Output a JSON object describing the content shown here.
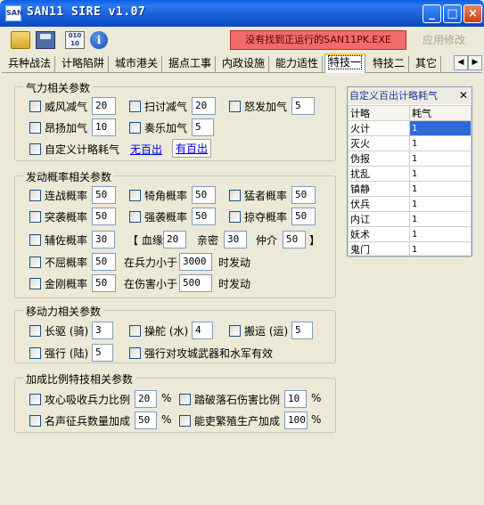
{
  "window": {
    "title": "SAN11 SIRE v1.07",
    "icon_text": "SAN"
  },
  "toolbar": {
    "status_text": "没有找到正运行的SAN11PK.EXE",
    "apply_label": "应用修改",
    "calc_icon_text": "010\n10"
  },
  "tabs": [
    {
      "label": "兵种战法"
    },
    {
      "label": "计略陷阱"
    },
    {
      "label": "城市港关"
    },
    {
      "label": "据点工事"
    },
    {
      "label": "内政设施"
    },
    {
      "label": "能力适性"
    },
    {
      "label": "特技一"
    },
    {
      "label": "特技二"
    },
    {
      "label": "其它"
    }
  ],
  "active_tab": "特技一",
  "groups": {
    "qili": {
      "title": "气力相关参数",
      "weifeng": {
        "label": "威风减气",
        "value": "20"
      },
      "saotao": {
        "label": "扫讨减气",
        "value": "20"
      },
      "nufa": {
        "label": "怒发加气",
        "value": "5"
      },
      "angyang": {
        "label": "昂扬加气",
        "value": "10"
      },
      "zouyue": {
        "label": "奏乐加气",
        "value": "5"
      },
      "custom": {
        "label": "自定义计略耗气",
        "link1": "无百出",
        "link2": "有百出"
      }
    },
    "fadong": {
      "title": "发动概率相关参数",
      "lianzhan": {
        "label": "连战概率",
        "value": "50"
      },
      "jijiao": {
        "label": "犄角概率",
        "value": "50"
      },
      "mengzhe": {
        "label": "猛者概率",
        "value": "50"
      },
      "tuxi": {
        "label": "突袭概率",
        "value": "50"
      },
      "qiangxi": {
        "label": "强袭概率",
        "value": "50"
      },
      "luoduo": {
        "label": "掠夺概率",
        "value": "50"
      },
      "fuzuo": {
        "label": "辅佐概率",
        "value": "30"
      },
      "xueyuan": {
        "label": "【 血缘",
        "value": "20"
      },
      "qinmi": {
        "label": "亲密",
        "value": "30"
      },
      "zhongjie": {
        "label": "仲介",
        "value": "50",
        "close": "】"
      },
      "buqu": {
        "label": "不屈概率",
        "value": "50",
        "pre": "在兵力小于",
        "threshold": "3000",
        "post": "时发动"
      },
      "jingang": {
        "label": "金刚概率",
        "value": "50",
        "pre": "在伤害小于",
        "threshold": "500",
        "post": "时发动"
      }
    },
    "yidong": {
      "title": "移动力相关参数",
      "changqu": {
        "label": "长驱 (骑)",
        "value": "3"
      },
      "caotuo": {
        "label": "操舵 (水)",
        "value": "4"
      },
      "banyun": {
        "label": "搬运 (运)",
        "value": "5"
      },
      "qiangxing": {
        "label": "强行 (陆)",
        "value": "5"
      },
      "gongcheng": {
        "label": "强行对攻城武器和水军有效"
      }
    },
    "jiacheng": {
      "title": "加成比例特技相关参数",
      "gongxin": {
        "label": "攻心吸收兵力比例",
        "value": "20",
        "unit": "%"
      },
      "tapo": {
        "label": "踏破落石伤害比例",
        "value": "10",
        "unit": "%"
      },
      "mingsheng": {
        "label": "名声征兵数量加成",
        "value": "50",
        "unit": "%"
      },
      "nenglibian": {
        "label": "能吏繁殖生产加成",
        "value": "100",
        "unit": "%"
      }
    }
  },
  "side_panel": {
    "title": "自定义百出计略耗气",
    "col1": "计略",
    "col2": "耗气",
    "rows": [
      {
        "name": "火计",
        "value": "1"
      },
      {
        "name": "灭火",
        "value": "1"
      },
      {
        "name": "伪报",
        "value": "1"
      },
      {
        "name": "扰乱",
        "value": "1"
      },
      {
        "name": "镇静",
        "value": "1"
      },
      {
        "name": "伏兵",
        "value": "1"
      },
      {
        "name": "内讧",
        "value": "1"
      },
      {
        "name": "妖术",
        "value": "1"
      },
      {
        "name": "鬼门",
        "value": "1"
      }
    ]
  }
}
